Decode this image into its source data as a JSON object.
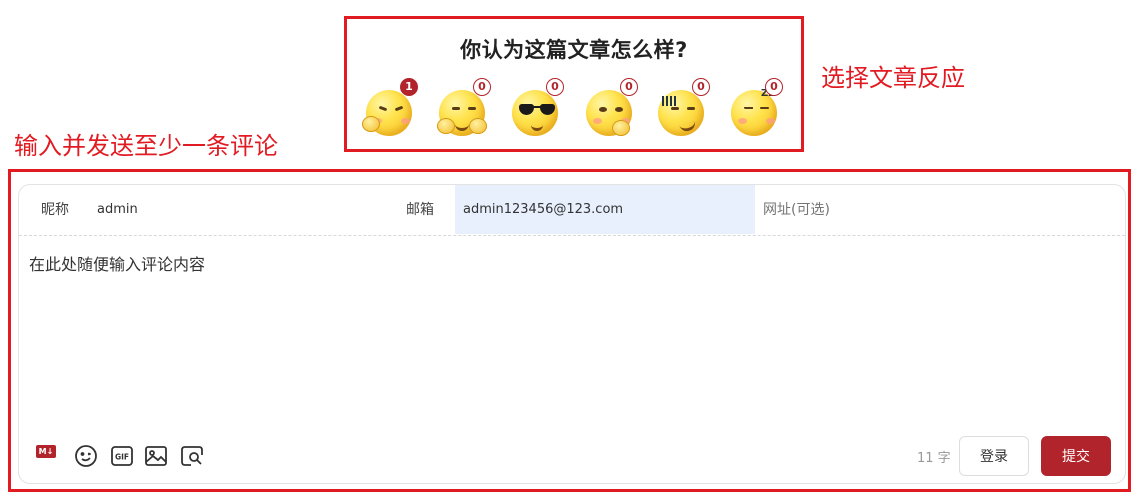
{
  "annotations": {
    "reaction_callout": "选择文章反应",
    "comment_callout": "输入并发送至少一条评论"
  },
  "reactions": {
    "title": "你认为这篇文章怎么样?",
    "items": [
      {
        "icon": "angry-thinking-emoji-icon",
        "count": "1",
        "active": true
      },
      {
        "icon": "grinning-hands-emoji-icon",
        "count": "0"
      },
      {
        "icon": "sunglasses-emoji-icon",
        "count": "0"
      },
      {
        "icon": "thinking-emoji-icon",
        "count": "0"
      },
      {
        "icon": "sweat-smirk-emoji-icon",
        "count": "0"
      },
      {
        "icon": "sleepy-emoji-icon",
        "count": "0"
      }
    ]
  },
  "comment_form": {
    "nickname_label": "昵称",
    "nickname_value": "admin",
    "email_label": "邮箱",
    "email_value": "admin123456@123.com",
    "website_placeholder": "网址(可选)",
    "content": "在此处随便输入评论内容",
    "toolbar": [
      "markdown-icon",
      "emoji-icon",
      "gif-icon",
      "image-icon",
      "preview-icon"
    ],
    "markdown_label": "M↓",
    "gif_label": "GIF",
    "word_count": "11 字",
    "login_label": "登录",
    "submit_label": "提交"
  },
  "colors": {
    "annotation_red": "#e21b23",
    "accent": "#b2242b",
    "email_highlight": "#e8f0fe"
  }
}
